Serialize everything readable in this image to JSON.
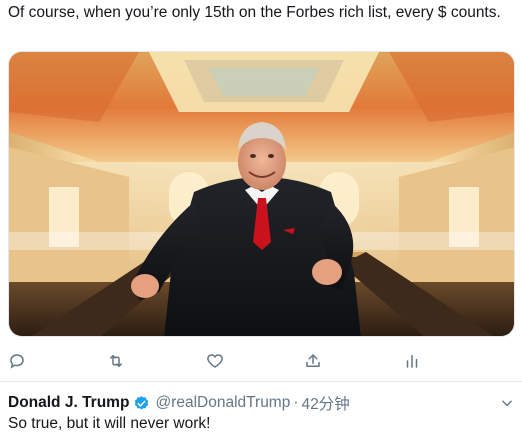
{
  "tweet": {
    "text": "Of course, when you’re only 15th on the Forbes rich list, every $ counts."
  },
  "actions": {
    "reply_icon": "reply-icon",
    "retweet_icon": "retweet-icon",
    "like_icon": "heart-icon",
    "share_icon": "share-icon",
    "analytics_icon": "analytics-icon",
    "icon_color": "#657786"
  },
  "reply": {
    "name": "Donald J. Trump",
    "handle": "@realDonaldTrump",
    "separator": "·",
    "time": "42分钟",
    "text": "So true, but it will never work!",
    "verified_color": "#1da1f2"
  }
}
